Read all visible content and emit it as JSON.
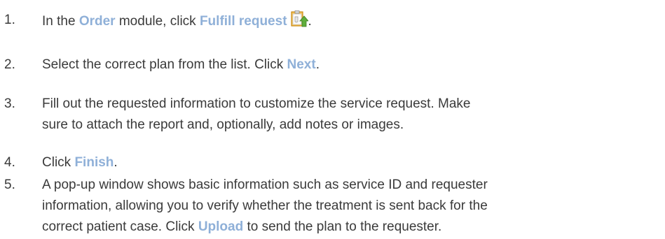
{
  "steps": [
    {
      "number": "1.",
      "pre": "In the ",
      "kw1": "Order",
      "mid": " module, click ",
      "kw2": "Fulfill request",
      "icon": "fulfill-request-icon",
      "post": "."
    },
    {
      "number": "2.",
      "pre": "Select the correct plan from the list. Click ",
      "kw": "Next",
      "post": "."
    },
    {
      "number": "3.",
      "line1": "Fill out the requested information to customize the service request. Make",
      "line2": "sure to attach the report and, optionally, add notes or images."
    },
    {
      "number": "4.",
      "pre": "Click ",
      "kw": "Finish",
      "post": "."
    },
    {
      "number": "5.",
      "line1": "A pop-up window shows basic information such as service ID and requester",
      "line2": "information, allowing you to verify whether the treatment is sent back for the",
      "line3_pre": "correct patient case. Click ",
      "line3_kw": "Upload",
      "line3_post": " to send the plan to the requester."
    }
  ],
  "colors": {
    "text": "#3a3a3a",
    "keyword": "#8fb0d8",
    "icon_orange": "#f0a020",
    "icon_green": "#5fae3c"
  }
}
